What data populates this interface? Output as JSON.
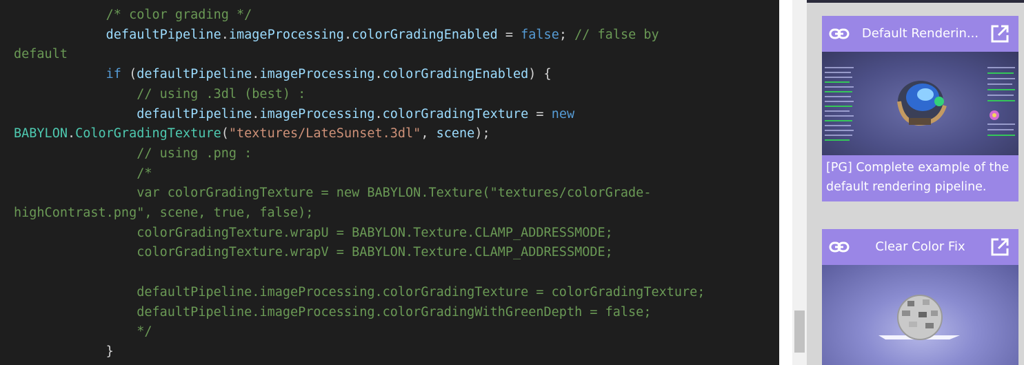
{
  "editor": {
    "lines": [
      [
        {
          "t": "            "
        },
        {
          "c": "t-comment",
          "t": "/* color grading */"
        }
      ],
      [
        {
          "t": "            "
        },
        {
          "c": "t-ident",
          "t": "defaultPipeline"
        },
        {
          "c": "t-plain",
          "t": "."
        },
        {
          "c": "t-ident",
          "t": "imageProcessing"
        },
        {
          "c": "t-plain",
          "t": "."
        },
        {
          "c": "t-ident",
          "t": "colorGradingEnabled"
        },
        {
          "c": "t-plain",
          "t": " = "
        },
        {
          "c": "t-kw",
          "t": "false"
        },
        {
          "c": "t-plain",
          "t": "; "
        },
        {
          "c": "t-comment",
          "t": "// false by"
        }
      ],
      [
        {
          "c": "t-comment",
          "t": "default"
        }
      ],
      [
        {
          "t": "            "
        },
        {
          "c": "t-kw",
          "t": "if"
        },
        {
          "c": "t-plain",
          "t": " ("
        },
        {
          "c": "t-ident",
          "t": "defaultPipeline"
        },
        {
          "c": "t-plain",
          "t": "."
        },
        {
          "c": "t-ident",
          "t": "imageProcessing"
        },
        {
          "c": "t-plain",
          "t": "."
        },
        {
          "c": "t-ident",
          "t": "colorGradingEnabled"
        },
        {
          "c": "t-plain",
          "t": ") {"
        }
      ],
      [
        {
          "t": "                "
        },
        {
          "c": "t-comment",
          "t": "// using .3dl (best) :"
        }
      ],
      [
        {
          "t": "                "
        },
        {
          "c": "t-ident",
          "t": "defaultPipeline"
        },
        {
          "c": "t-plain",
          "t": "."
        },
        {
          "c": "t-ident",
          "t": "imageProcessing"
        },
        {
          "c": "t-plain",
          "t": "."
        },
        {
          "c": "t-ident",
          "t": "colorGradingTexture"
        },
        {
          "c": "t-plain",
          "t": " = "
        },
        {
          "c": "t-kw",
          "t": "new"
        }
      ],
      [
        {
          "c": "t-type",
          "t": "BABYLON"
        },
        {
          "c": "t-plain",
          "t": "."
        },
        {
          "c": "t-type",
          "t": "ColorGradingTexture"
        },
        {
          "c": "t-plain",
          "t": "("
        },
        {
          "c": "t-str",
          "t": "\"textures/LateSunset.3dl\""
        },
        {
          "c": "t-plain",
          "t": ", "
        },
        {
          "c": "t-ident",
          "t": "scene"
        },
        {
          "c": "t-plain",
          "t": ");"
        }
      ],
      [
        {
          "t": "                "
        },
        {
          "c": "t-comment",
          "t": "// using .png :"
        }
      ],
      [
        {
          "t": "                "
        },
        {
          "c": "t-comment",
          "t": "/*"
        }
      ],
      [
        {
          "t": "                "
        },
        {
          "c": "t-comment",
          "t": "var colorGradingTexture = new BABYLON.Texture(\"textures/colorGrade-"
        }
      ],
      [
        {
          "c": "t-comment",
          "t": "highContrast.png\", scene, true, false);"
        }
      ],
      [
        {
          "t": "                "
        },
        {
          "c": "t-comment",
          "t": "colorGradingTexture.wrapU = BABYLON.Texture.CLAMP_ADDRESSMODE;"
        }
      ],
      [
        {
          "t": "                "
        },
        {
          "c": "t-comment",
          "t": "colorGradingTexture.wrapV = BABYLON.Texture.CLAMP_ADDRESSMODE;"
        }
      ],
      [
        {
          "t": ""
        }
      ],
      [
        {
          "t": "                "
        },
        {
          "c": "t-comment",
          "t": "defaultPipeline.imageProcessing.colorGradingTexture = colorGradingTexture;"
        }
      ],
      [
        {
          "t": "                "
        },
        {
          "c": "t-comment",
          "t": "defaultPipeline.imageProcessing.colorGradingWithGreenDepth = false;"
        }
      ],
      [
        {
          "t": "                "
        },
        {
          "c": "t-comment",
          "t": "*/"
        }
      ],
      [
        {
          "t": "            "
        },
        {
          "c": "t-plain",
          "t": "}"
        }
      ]
    ]
  },
  "sidebar": {
    "cards": [
      {
        "title": "Default Renderin...",
        "description": "[PG] Complete example of the default rendering pipeline.",
        "link_icon": "link-icon",
        "open_icon": "open-in-new-icon"
      },
      {
        "title": "Clear Color Fix",
        "link_icon": "link-icon",
        "open_icon": "open-in-new-icon"
      }
    ]
  },
  "colors": {
    "editor_bg": "#1e1e1e",
    "card_accent": "#9a86e6",
    "sidebar_bg": "#d6d6d6",
    "comment": "#6a9955",
    "keyword": "#569cd6",
    "identifier": "#9cdcfe",
    "type": "#4ec9b0",
    "string": "#ce9178"
  }
}
